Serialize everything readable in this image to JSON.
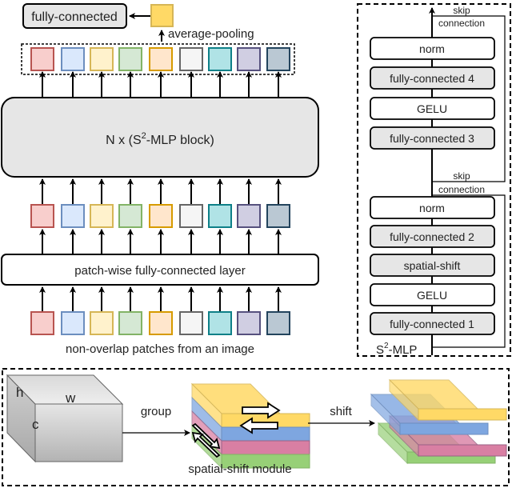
{
  "main_pipeline": {
    "classifier_label": "fully-connected",
    "pooling_label": "average-pooling",
    "block_label_prefix": "N x (S",
    "block_label_sup": "2",
    "block_label_suffix": "-MLP block)",
    "patch_fc_label": "patch-wise fully-connected layer",
    "patches_caption": "non-overlap patches from an image",
    "patch_count": 9,
    "patch_colors": [
      {
        "fill": "#f8cecc",
        "stroke": "#b85450"
      },
      {
        "fill": "#dae8fc",
        "stroke": "#6c8ebf"
      },
      {
        "fill": "#fff2cc",
        "stroke": "#d6b656"
      },
      {
        "fill": "#d5e8d4",
        "stroke": "#82b366"
      },
      {
        "fill": "#ffe6cc",
        "stroke": "#d79b00"
      },
      {
        "fill": "#f5f5f5",
        "stroke": "#666666"
      },
      {
        "fill": "#b0e3e6",
        "stroke": "#0e8088"
      },
      {
        "fill": "#d0cee2",
        "stroke": "#56517e"
      },
      {
        "fill": "#bac8d3",
        "stroke": "#23445d"
      }
    ],
    "pooled_color": {
      "fill": "#ffd966",
      "stroke": "#d6b656"
    }
  },
  "s2mlp_panel": {
    "title_prefix": "S",
    "title_sup": "2",
    "title_suffix": "-MLP",
    "skip_label_line1": "skip",
    "skip_label_line2": "connection",
    "upper_layers": [
      "norm",
      "fully-connected 4",
      "GELU",
      "fully-connected 3"
    ],
    "lower_layers": [
      "norm",
      "fully-connected 2",
      "spatial-shift",
      "GELU",
      "fully-connected 1"
    ],
    "upper_shaded": [
      false,
      true,
      false,
      true
    ],
    "lower_shaded": [
      false,
      true,
      true,
      false,
      true
    ]
  },
  "shift_module": {
    "cube_labels": {
      "h": "h",
      "w": "w",
      "c": "c"
    },
    "group_label": "group",
    "module_caption": "spatial-shift module",
    "shift_label": "shift",
    "group_colors": [
      {
        "name": "yellow",
        "fill": "#ffd966",
        "stroke": "#d6b656"
      },
      {
        "name": "blue",
        "fill": "#7ea6e0",
        "stroke": "#6c8ebf"
      },
      {
        "name": "pink",
        "fill": "#d97fa3",
        "stroke": "#996185"
      },
      {
        "name": "green",
        "fill": "#97d077",
        "stroke": "#82b366"
      }
    ]
  }
}
